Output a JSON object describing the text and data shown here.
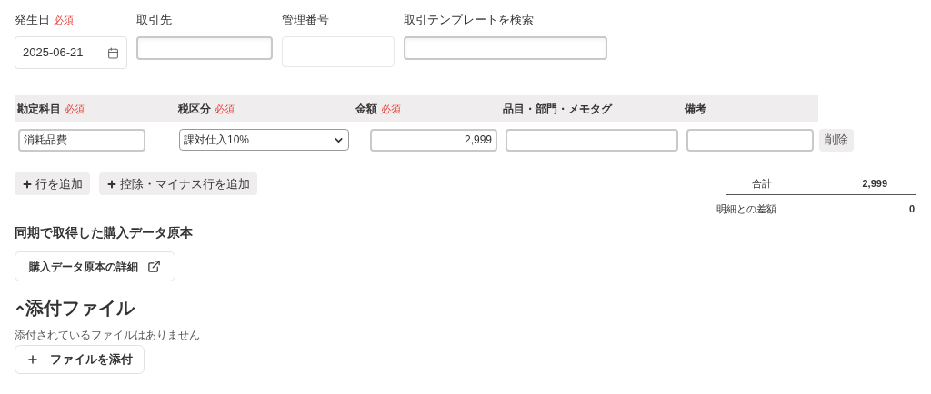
{
  "header_fields": [
    {
      "kind": "date",
      "label": "発生日",
      "badge": "必須",
      "value": "2025-06-21"
    },
    {
      "kind": "text",
      "label": "取引先"
    },
    {
      "kind": "readonly",
      "label": "管理番号"
    },
    {
      "kind": "search",
      "label": "取引テンプレートを検索"
    }
  ],
  "table": {
    "columns": [
      {
        "label": "勘定科目",
        "badge": "必須"
      },
      {
        "label": "税区分",
        "badge": "必須"
      },
      {
        "label": "金額",
        "badge": "必須"
      },
      {
        "label": "品目・部門・メモタグ"
      },
      {
        "label": "備考"
      }
    ],
    "rows": [
      {
        "account": "消耗品費",
        "tax": "課対仕入10%",
        "amount": "2,999",
        "delete": "削除"
      }
    ]
  },
  "row_buttons": [
    "行を追加",
    "控除・マイナス行を追加"
  ],
  "totals": [
    {
      "label": "合計",
      "value": "2,999",
      "kind": "total"
    },
    {
      "label": "明細との差額",
      "value": "0",
      "kind": "diff"
    }
  ],
  "source": {
    "title": "同期で取得した購入データ原本",
    "button": "購入データ原本の詳細"
  },
  "attachments": {
    "title": "添付ファイル",
    "expanded": true,
    "empty_text": "添付されているファイルはありません",
    "button": "ファイルを添付"
  }
}
